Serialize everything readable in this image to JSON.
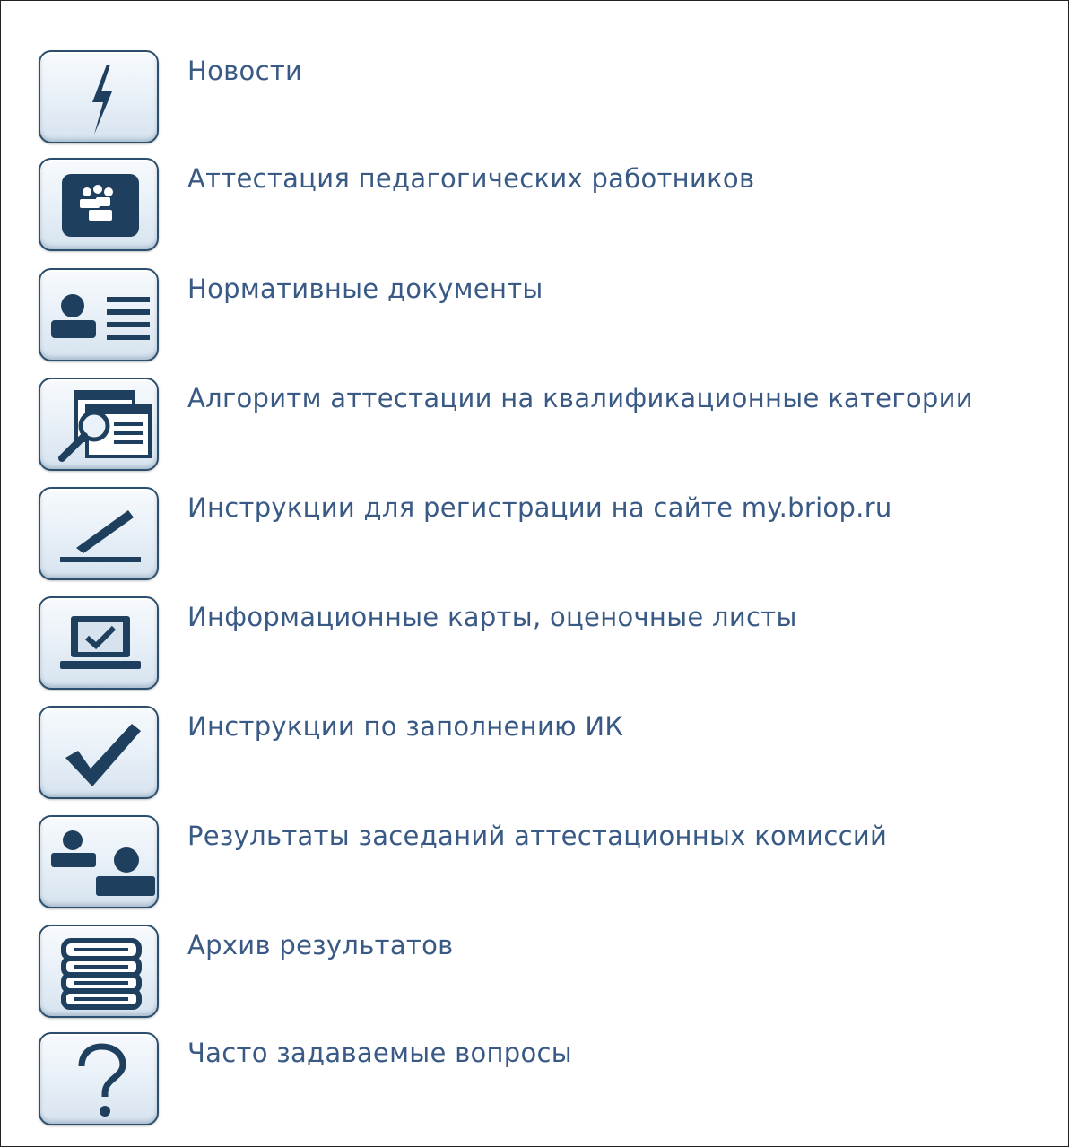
{
  "menu": {
    "items": [
      {
        "label": "Новости",
        "icon": "lightning-icon"
      },
      {
        "label": "Аттестация педагогических работников",
        "icon": "people-card-icon"
      },
      {
        "label": "Нормативные документы",
        "icon": "profile-document-icon"
      },
      {
        "label": "Алгоритм аттестации на квалификационные категории",
        "icon": "magnifier-window-icon"
      },
      {
        "label": "Инструкции для регистрации на сайте my.briop.ru",
        "icon": "pen-signature-icon"
      },
      {
        "label": "Информационные карты, оценочные листы",
        "icon": "laptop-check-icon"
      },
      {
        "label": "Инструкции по заполнению ИК",
        "icon": "checkmark-icon"
      },
      {
        "label": "Результаты заседаний аттестационных комиссий",
        "icon": "users-group-icon"
      },
      {
        "label": "Архив результатов",
        "icon": "archive-stack-icon"
      },
      {
        "label": "Часто задаваемые вопросы",
        "icon": "question-mark-icon"
      }
    ]
  },
  "colors": {
    "link": "#3a5a86",
    "icon": "#1f3f5e",
    "tile_border": "#2d4f6e"
  }
}
